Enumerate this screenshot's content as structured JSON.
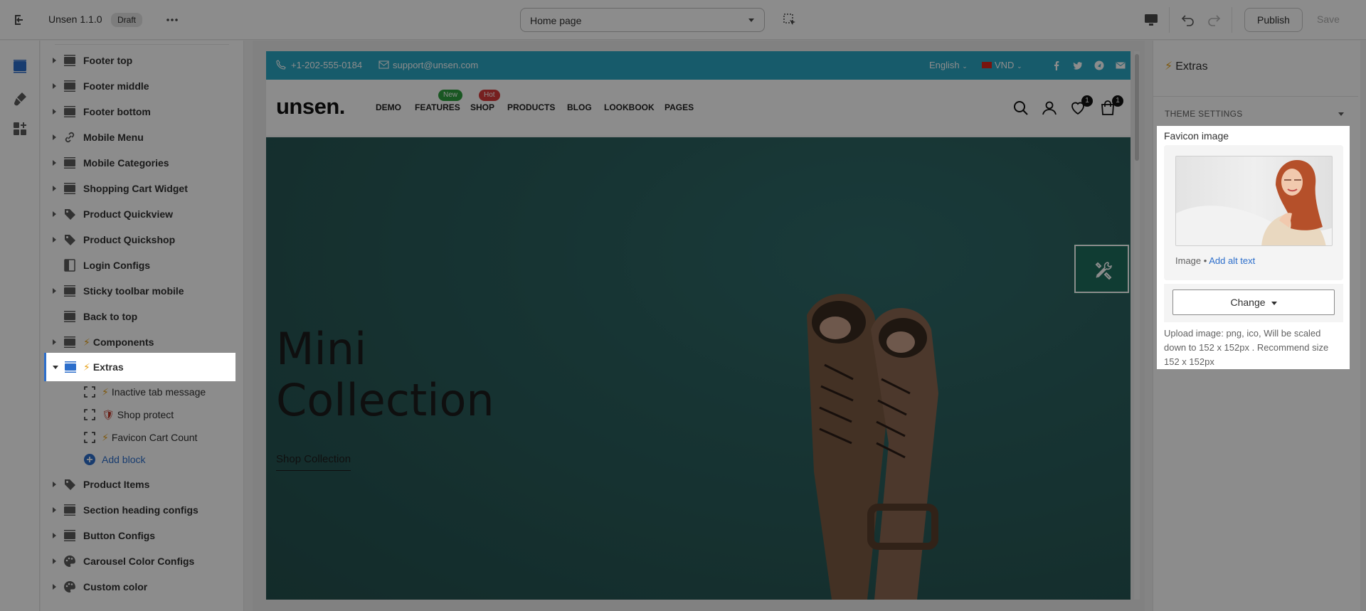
{
  "topbar": {
    "app_title": "Unsen 1.1.0",
    "status_badge": "Draft",
    "page_select_value": "Home page",
    "publish_label": "Publish",
    "save_label": "Save"
  },
  "sidebar": {
    "items": [
      {
        "label": "Footer top",
        "icon": "section-icon"
      },
      {
        "label": "Footer middle",
        "icon": "section-icon"
      },
      {
        "label": "Footer bottom",
        "icon": "section-icon"
      },
      {
        "label": "Mobile Menu",
        "icon": "link-icon"
      },
      {
        "label": "Mobile Categories",
        "icon": "section-icon"
      },
      {
        "label": "Shopping Cart Widget",
        "icon": "section-icon"
      },
      {
        "label": "Product Quickview",
        "icon": "tag-icon"
      },
      {
        "label": "Product Quickshop",
        "icon": "tag-icon"
      },
      {
        "label": "Login Configs",
        "icon": "sidebar-layout-icon"
      },
      {
        "label": "Sticky toolbar mobile",
        "icon": "section-icon"
      },
      {
        "label": "Back to top",
        "icon": "section-icon"
      },
      {
        "label": "Components",
        "icon": "section-icon",
        "prefix": "⚡"
      },
      {
        "label": "Extras",
        "icon": "section-icon",
        "prefix": "⚡"
      }
    ],
    "extras_children": [
      {
        "label": "Inactive tab message",
        "prefix": "⚡"
      },
      {
        "label": "Shop protect",
        "prefix": "🛡"
      },
      {
        "label": "Favicon Cart Count",
        "prefix": "⚡"
      }
    ],
    "add_block_label": "Add block",
    "items_after": [
      {
        "label": "Product Items",
        "icon": "tag-icon"
      },
      {
        "label": "Section heading configs",
        "icon": "section-icon"
      },
      {
        "label": "Button Configs",
        "icon": "section-icon"
      },
      {
        "label": "Carousel Color Configs",
        "icon": "palette-icon"
      },
      {
        "label": "Custom color",
        "icon": "palette-icon"
      }
    ]
  },
  "preview": {
    "phone": "+1-202-555-0184",
    "email": "support@unsen.com",
    "language": "English",
    "currency": "VND",
    "logo": "unsen.",
    "nav": [
      "DEMO",
      "FEATURES",
      "SHOP",
      "PRODUCTS",
      "BLOG",
      "LOOKBOOK",
      "PAGES"
    ],
    "nav_tag_new": "New",
    "nav_tag_hot": "Hot",
    "wishlist_count": "1",
    "cart_count": "1",
    "hero_title_line1": "Mini",
    "hero_title_line2": "Collection",
    "hero_link": "Shop Collection"
  },
  "right_panel": {
    "title": "Extras",
    "section": "THEME SETTINGS",
    "favicon_label": "Favicon image",
    "image_meta": "Image",
    "alt_link": "Add alt text",
    "change_label": "Change",
    "help_text": "Upload image: png, ico, Will be scaled down to 152 x 152px . Recommend size 152 x 152px"
  },
  "colors": {
    "accent": "#2c6ecb",
    "announce_bar": "#2aa6c3",
    "hero_bg": "#2a5f5d",
    "tag_new": "#2e9e3e",
    "tag_hot": "#d83a3a",
    "tool_button": "#1e6e5e"
  }
}
